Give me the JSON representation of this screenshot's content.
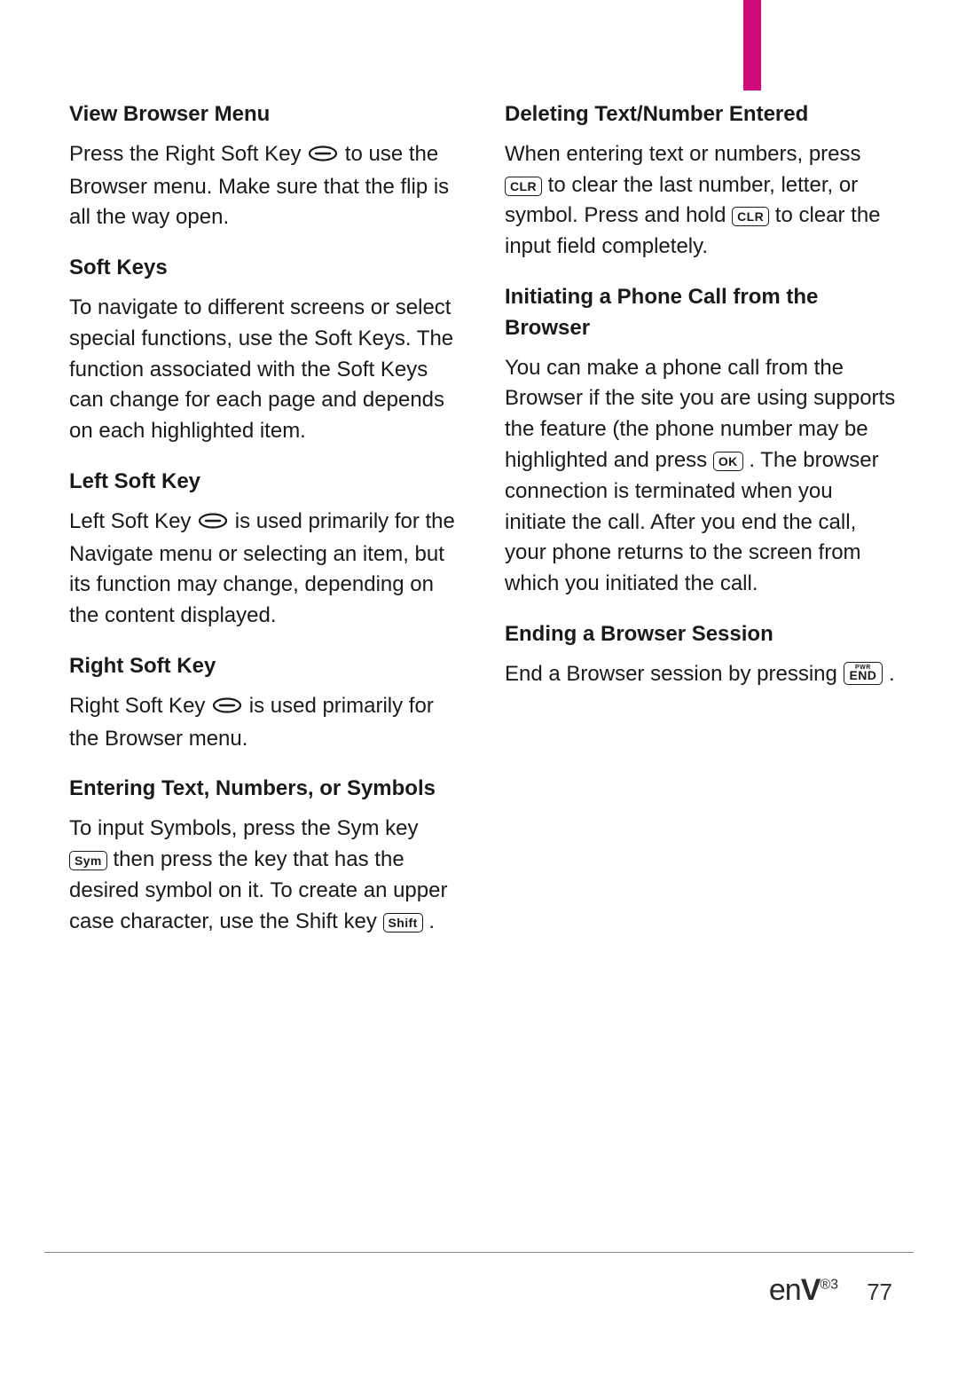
{
  "page_number": "77",
  "logo": {
    "prefix": "en",
    "v": "V",
    "sup": "®3"
  },
  "left": {
    "s1": {
      "h": "View Browser Menu",
      "p_a": "Press the Right Soft Key ",
      "p_b": " to use the Browser menu. Make sure that the flip is all the way open."
    },
    "s2": {
      "h": "Soft Keys",
      "p": "To navigate to different screens or select special functions, use the Soft Keys. The function associated with the Soft Keys can change for each page and depends on each highlighted item."
    },
    "s3": {
      "h": "Left Soft Key",
      "p_a": "Left Soft Key ",
      "p_b": " is used primarily for the Navigate menu or selecting an item, but its function may change, depending on the content displayed."
    },
    "s4": {
      "h": "Right Soft Key",
      "p_a": "Right Soft Key ",
      "p_b": " is used primarily for the Browser menu."
    },
    "s5": {
      "h": "Entering Text, Numbers, or Symbols",
      "p_a": "To input Symbols, press the Sym key ",
      "p_b": " then press the key that has the desired symbol on it. To create an upper case character, use the Shift key ",
      "p_c": " ."
    }
  },
  "right": {
    "s1": {
      "h": "Deleting Text/Number Entered",
      "p_a": "When entering text or numbers, press ",
      "p_b": " to clear the last number, letter, or symbol. Press and hold ",
      "p_c": " to clear the input field completely."
    },
    "s2": {
      "h": "Initiating a Phone Call from the Browser",
      "p_a": "You can make a phone call from the Browser if the site you are using supports the feature (the phone number may be highlighted and press ",
      "p_b": ". The browser connection is terminated when you initiate the call. After you end the call, your phone returns to the screen from which you initiated the call."
    },
    "s3": {
      "h": "Ending a Browser Session",
      "p_a": "End a Browser session by pressing ",
      "p_b": " ."
    }
  },
  "keys": {
    "sym": "Sym",
    "shift": "Shift",
    "clr": "CLR",
    "ok": "OK",
    "end_pwr": "PWR",
    "end": "END"
  }
}
